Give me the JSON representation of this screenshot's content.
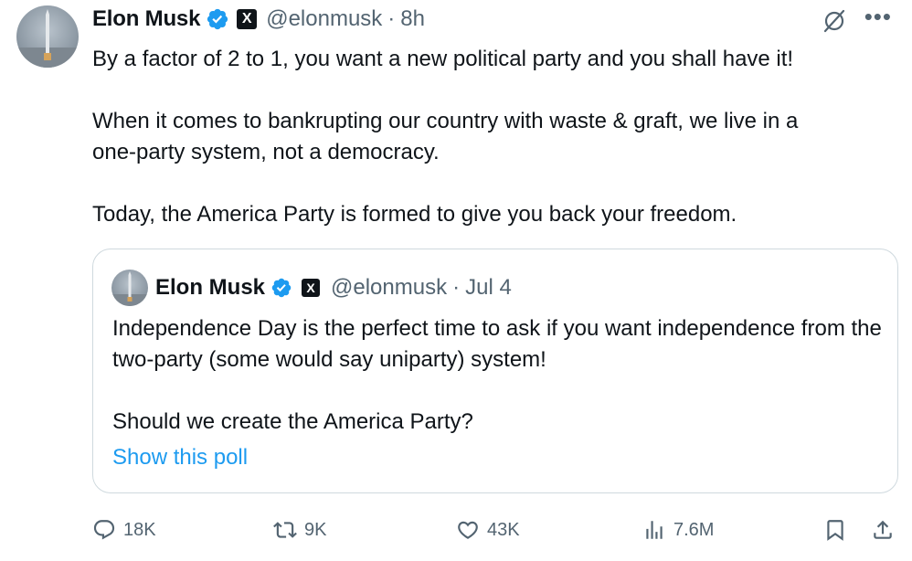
{
  "author": {
    "name": "Elon Musk",
    "handle": "@elonmusk",
    "separator": "·",
    "time": "8h",
    "x_badge": "X"
  },
  "tweet": {
    "para1": "By a factor of 2 to 1, you want a new political party and you shall have it!",
    "para2": "When it comes to bankrupting our country with waste & graft, we live in a\none-party system, not a democracy.",
    "para3": "Today, the America Party is formed to give you back your freedom."
  },
  "quoted": {
    "name": "Elon Musk",
    "handle": "@elonmusk",
    "separator": "·",
    "time": "Jul 4",
    "x_badge": "X",
    "para1": "Independence Day is the perfect time to ask if you want independence from the two-party (some would say uniparty) system!",
    "para2": "Should we create the America Party?",
    "show_poll": "Show this poll"
  },
  "actions": {
    "replies": "18K",
    "reposts": "9K",
    "likes": "43K",
    "views": "7.6M"
  },
  "icons": {
    "verified": "verified-badge-icon",
    "grok": "grok-icon",
    "more": "more-icon",
    "reply": "reply-icon",
    "repost": "repost-icon",
    "like": "heart-icon",
    "views": "views-icon",
    "bookmark": "bookmark-icon",
    "share": "share-icon"
  },
  "colors": {
    "accent": "#1d9bf0",
    "text": "#0f1419",
    "secondary": "#536471",
    "border": "#cfd9de"
  }
}
